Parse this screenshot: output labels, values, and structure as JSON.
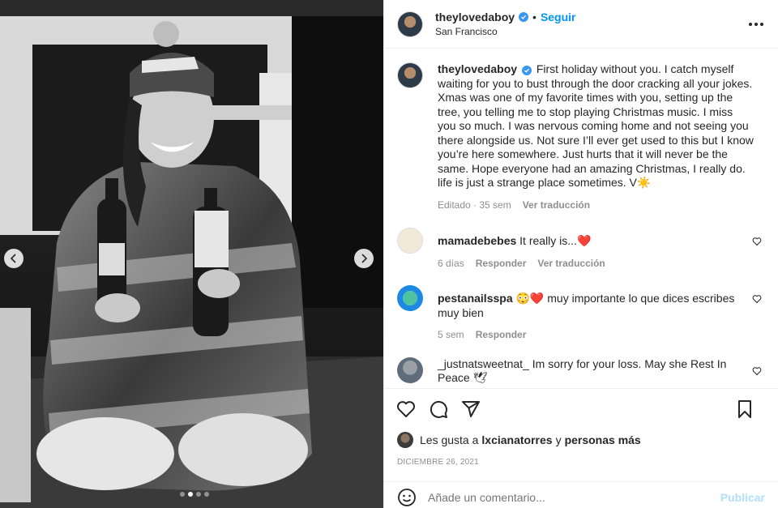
{
  "post": {
    "username": "theylovedaboy",
    "follow_label": "Seguir",
    "separator": "•",
    "location": "San Francisco"
  },
  "caption": {
    "username": "theylovedaboy",
    "text": "First holiday without you. I catch myself waiting for you to bust through the door cracking all your jokes. Xmas was one of my favorite times with you, setting up the tree, you telling me to stop playing Christmas music. I miss you so much. I was nervous coming home and not seeing you there alongside us. Not sure I’ll ever get used to this but I know you’re here somewhere. Just hurts that it will never be the same. Hope everyone had an amazing Christmas, I really do.",
    "text2": "life is just a strange place sometimes. V☀️",
    "edited": "Editado · 35 sem",
    "translate": "Ver traducción"
  },
  "comments": [
    {
      "username": "mamadebebes",
      "text": "It really is...❤️",
      "time": "6 días",
      "reply": "Responder",
      "translate": "Ver traducción"
    },
    {
      "username": "pestanailsspa",
      "text": "😳❤️ muy importante lo que dices escribes muy bien",
      "time": "5 sem",
      "reply": "Responder"
    },
    {
      "username": "_justnatsweetnat_",
      "text": "Im sorry for your loss. May she Rest In Peace 🕊"
    }
  ],
  "likes": {
    "prefix": "Les gusta a",
    "user": "lxcianatorres",
    "conj": "y",
    "others": "personas más"
  },
  "date": "DICIEMBRE 26, 2021",
  "add_comment": {
    "placeholder": "Añade un comentario...",
    "post_label": "Publicar"
  },
  "colors": {
    "link": "#0095f6",
    "verified": "#3897f0",
    "heart": "#ed4956"
  },
  "icons": [
    "verified-icon",
    "more-options-icon",
    "heart-icon",
    "comment-icon",
    "share-icon",
    "bookmark-icon",
    "emoji-icon",
    "chevron-left-icon",
    "chevron-right-icon"
  ]
}
